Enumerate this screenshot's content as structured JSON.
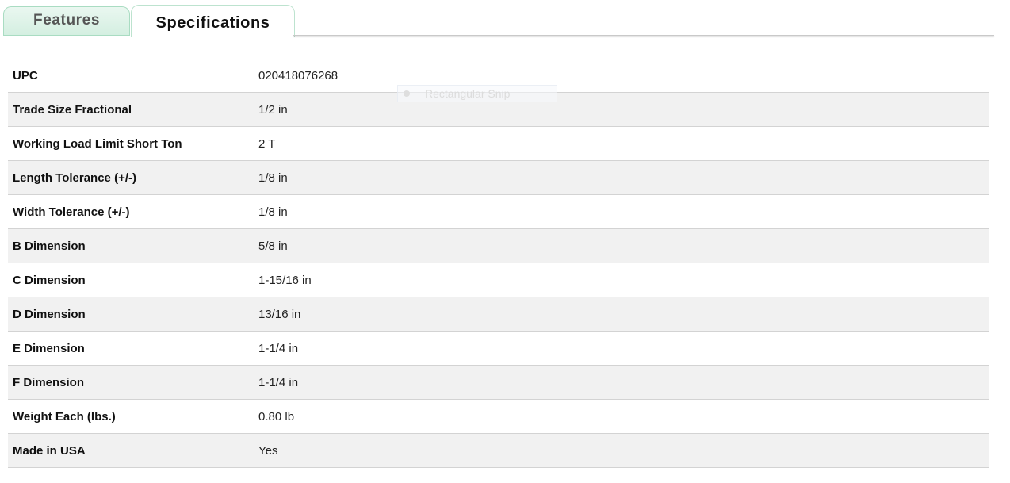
{
  "tabs": [
    {
      "label": "Features",
      "active": false
    },
    {
      "label": "Specifications",
      "active": true
    }
  ],
  "specs": [
    {
      "label": "UPC",
      "value": "020418076268"
    },
    {
      "label": "Trade Size Fractional",
      "value": "1/2 in"
    },
    {
      "label": "Working Load Limit Short Ton",
      "value": "2 T"
    },
    {
      "label": "Length Tolerance (+/-)",
      "value": "1/8 in"
    },
    {
      "label": "Width Tolerance (+/-)",
      "value": "1/8 in"
    },
    {
      "label": "B Dimension",
      "value": "5/8 in"
    },
    {
      "label": "C Dimension",
      "value": "1-15/16 in"
    },
    {
      "label": "D Dimension",
      "value": "13/16 in"
    },
    {
      "label": "E Dimension",
      "value": "1-1/4 in"
    },
    {
      "label": "F Dimension",
      "value": "1-1/4 in"
    },
    {
      "label": "Weight Each (lbs.)",
      "value": "0.80 lb"
    },
    {
      "label": "Made in USA",
      "value": "Yes"
    }
  ],
  "snip_overlay": {
    "label": "Rectangular Snip",
    "icon": "record-dot-icon"
  },
  "colors": {
    "tab_inactive_bg": "#d4efe1",
    "tab_border": "#a9dcc2",
    "row_alt_bg": "#f1f1f1",
    "row_border": "#d3d3d3"
  }
}
